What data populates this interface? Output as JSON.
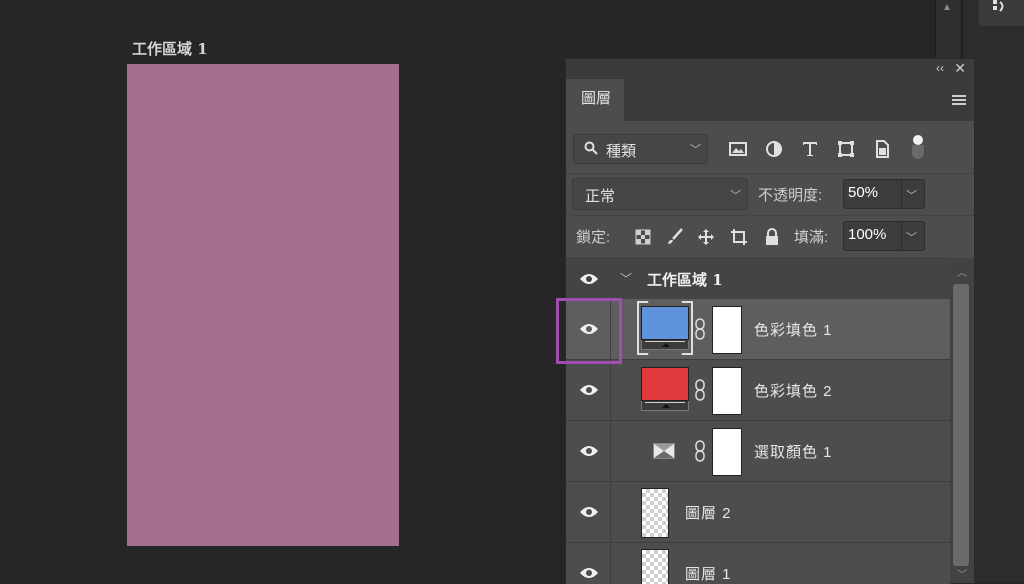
{
  "canvas": {
    "artboard_title": "工作區域 1",
    "artboard_color": "#a2708d"
  },
  "panel": {
    "tab_label": "圖層",
    "collapse_glyph": "‹‹",
    "close_glyph": "✕",
    "filter": {
      "kind_label": "種類"
    },
    "blend": {
      "mode": "正常",
      "opacity_label": "不透明度:",
      "opacity_value": "50%"
    },
    "lock": {
      "label": "鎖定:",
      "fill_label": "填滿:",
      "fill_value": "100%"
    },
    "layers": [
      {
        "name": "工作區域 1",
        "type": "artboard-group",
        "visible": true
      },
      {
        "name": "色彩填色 1",
        "type": "color-fill",
        "color": "#5f93dc",
        "visible": true,
        "selected": true
      },
      {
        "name": "色彩填色 2",
        "type": "color-fill",
        "color": "#e0383c",
        "visible": true
      },
      {
        "name": "選取顏色 1",
        "type": "selective-color",
        "visible": true
      },
      {
        "name": "圖層 2",
        "type": "pixel",
        "visible": true
      },
      {
        "name": "圖層 1",
        "type": "pixel",
        "visible": true
      }
    ]
  },
  "colors": {
    "highlight": "#a24db0",
    "panel_bg": "#4d4d4d",
    "app_bg": "#262626"
  }
}
